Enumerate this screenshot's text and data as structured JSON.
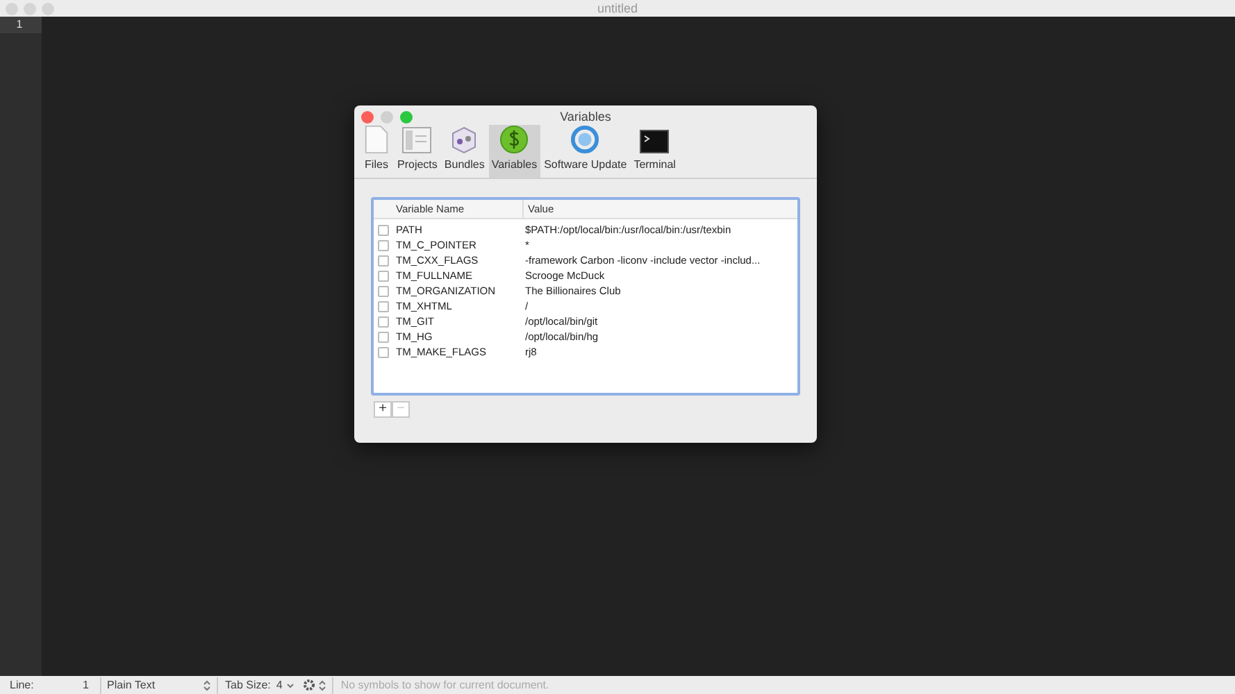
{
  "window": {
    "title": "untitled"
  },
  "gutter": {
    "line_numbers": [
      "1"
    ]
  },
  "dialog": {
    "title": "Variables",
    "tabs": [
      {
        "label": "Files",
        "kind": "files",
        "selected": false
      },
      {
        "label": "Projects",
        "kind": "projects",
        "selected": false
      },
      {
        "label": "Bundles",
        "kind": "bundles",
        "selected": false
      },
      {
        "label": "Variables",
        "kind": "variables",
        "selected": true
      },
      {
        "label": "Software Update",
        "kind": "update",
        "selected": false
      },
      {
        "label": "Terminal",
        "kind": "terminal",
        "selected": false
      }
    ],
    "table": {
      "columns": [
        "Variable Name",
        "Value"
      ],
      "rows": [
        {
          "checked": false,
          "name": "PATH",
          "value": "$PATH:/opt/local/bin:/usr/local/bin:/usr/texbin"
        },
        {
          "checked": false,
          "name": "TM_C_POINTER",
          "value": "*"
        },
        {
          "checked": false,
          "name": "TM_CXX_FLAGS",
          "value": "-framework Carbon -liconv -include vector -includ..."
        },
        {
          "checked": false,
          "name": "TM_FULLNAME",
          "value": "Scrooge McDuck"
        },
        {
          "checked": false,
          "name": "TM_ORGANIZATION",
          "value": "The Billionaires Club"
        },
        {
          "checked": false,
          "name": "TM_XHTML",
          "value": "/"
        },
        {
          "checked": false,
          "name": "TM_GIT",
          "value": "/opt/local/bin/git"
        },
        {
          "checked": false,
          "name": "TM_HG",
          "value": "/opt/local/bin/hg"
        },
        {
          "checked": false,
          "name": "TM_MAKE_FLAGS",
          "value": "rj8"
        }
      ]
    },
    "buttons": [
      {
        "label": "+",
        "disabled": false
      },
      {
        "label": "−",
        "disabled": true
      }
    ]
  },
  "status_bar": {
    "line_label": "Line:",
    "line": "1",
    "grammar": "Plain Text",
    "tab_size_label": "Tab Size:",
    "tab_size": "4",
    "symbols": "No symbols to show for current document."
  }
}
